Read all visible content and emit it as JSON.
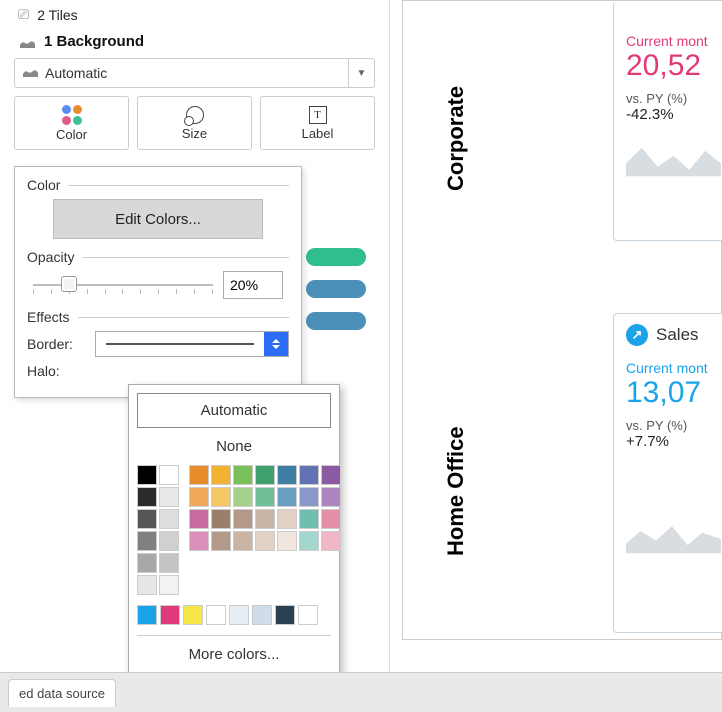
{
  "marks": {
    "prev_row": "2 Tiles",
    "current_row": "1 Background",
    "dropdown_value": "Automatic",
    "buttons": {
      "color": "Color",
      "size": "Size",
      "label": "Label"
    }
  },
  "color_popup": {
    "section_color": "Color",
    "edit_colors": "Edit Colors...",
    "section_opacity": "Opacity",
    "opacity_value": "20%",
    "section_effects": "Effects",
    "border_label": "Border:",
    "halo_label": "Halo:"
  },
  "picker": {
    "automatic": "Automatic",
    "none": "None",
    "more": "More colors...",
    "gray_swatches": [
      "#000000",
      "#ffffff",
      "#2b2b2b",
      "#e9e9e9",
      "#555555",
      "#dddddd",
      "#808080",
      "#d0d0d0",
      "#a8a8a8",
      "#c4c4c4",
      "#e6e6e6",
      "#f2f2f2"
    ],
    "main_swatches": [
      "#e88b2a",
      "#f2b233",
      "#7bbf5a",
      "#3f9f6d",
      "#3e7fa3",
      "#6173b3",
      "#8c5aa3",
      "#f0a85a",
      "#f5c766",
      "#a3d18a",
      "#6fbf97",
      "#6aa0bf",
      "#8a97c8",
      "#ad85bf",
      "#c76aa0",
      "#9a7f6d",
      "#b39a88",
      "#cab5a5",
      "#e1d0c3",
      "#6fbfb0",
      "#e38fa7",
      "#d98fb8",
      "#b39a88",
      "#cab5a5",
      "#e1d0c3",
      "#f0e6dd",
      "#a3d6cc",
      "#f0b8c6"
    ],
    "accent_swatches": [
      "#1aa3e8",
      "#e03a7a",
      "#f5e64a",
      "#ffffff",
      "#e6eef5",
      "#d0dce8",
      "#2b3f52",
      "#ffffff"
    ]
  },
  "dashboard": {
    "segments": {
      "corporate": "Corporate",
      "home_office": "Home Office"
    },
    "card1": {
      "metric_label": "Current mont",
      "metric_value": "20,52",
      "vs_label": "vs. PY (%)",
      "vs_value": "-42.3%"
    },
    "card2": {
      "title": "Sales",
      "metric_label": "Current mont",
      "metric_value": "13,07",
      "vs_label": "vs. PY (%)",
      "vs_value": "+7.7%"
    }
  },
  "bottom": {
    "tab": "ed data source"
  }
}
